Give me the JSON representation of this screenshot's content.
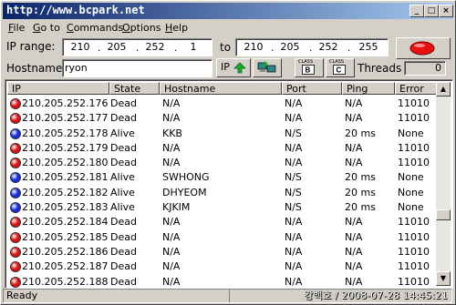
{
  "window": {
    "title": "http://www.bcpark.net",
    "min_glyph": "_",
    "max_glyph": "□",
    "close_glyph": "×"
  },
  "menu": [
    {
      "accel": "F",
      "rest": "ile"
    },
    {
      "accel": "G",
      "rest": "o to"
    },
    {
      "accel": "C",
      "rest": "ommands"
    },
    {
      "accel": "O",
      "rest": "ptions"
    },
    {
      "accel": "H",
      "rest": "elp"
    }
  ],
  "range": {
    "label": "IP range:",
    "from": [
      "210",
      "205",
      "252",
      "1"
    ],
    "to_label": "to",
    "to": [
      "210",
      "205",
      "252",
      "255"
    ]
  },
  "hostname": {
    "label": "Hostname:",
    "value": "ryon"
  },
  "tools": {
    "ip_up_label": "IP",
    "class_b_label": "CLASS",
    "class_c_label": "CLASS",
    "threads_label": "Threads",
    "threads_value": "0"
  },
  "columns": [
    "IP",
    "State",
    "Hostname",
    "Port",
    "Ping",
    "Error"
  ],
  "rows": [
    {
      "ip": "210.205.252.176",
      "state": "Dead",
      "host": "N/A",
      "port": "N/A",
      "ping": "N/A",
      "error": "11010",
      "color": "#e01010"
    },
    {
      "ip": "210.205.252.177",
      "state": "Dead",
      "host": "N/A",
      "port": "N/A",
      "ping": "N/A",
      "error": "11010",
      "color": "#e01010"
    },
    {
      "ip": "210.205.252.178",
      "state": "Alive",
      "host": "KKB",
      "port": "N/S",
      "ping": "20 ms",
      "error": "None",
      "color": "#1030e0"
    },
    {
      "ip": "210.205.252.179",
      "state": "Dead",
      "host": "N/A",
      "port": "N/A",
      "ping": "N/A",
      "error": "11010",
      "color": "#e01010"
    },
    {
      "ip": "210.205.252.180",
      "state": "Dead",
      "host": "N/A",
      "port": "N/A",
      "ping": "N/A",
      "error": "11010",
      "color": "#e01010"
    },
    {
      "ip": "210.205.252.181",
      "state": "Alive",
      "host": "SWHONG",
      "port": "N/S",
      "ping": "20 ms",
      "error": "None",
      "color": "#1030e0"
    },
    {
      "ip": "210.205.252.182",
      "state": "Alive",
      "host": "DHYEOM",
      "port": "N/S",
      "ping": "20 ms",
      "error": "None",
      "color": "#1030e0"
    },
    {
      "ip": "210.205.252.183",
      "state": "Alive",
      "host": "KJKIM",
      "port": "N/S",
      "ping": "20 ms",
      "error": "None",
      "color": "#1030e0"
    },
    {
      "ip": "210.205.252.184",
      "state": "Dead",
      "host": "N/A",
      "port": "N/A",
      "ping": "N/A",
      "error": "11010",
      "color": "#e01010"
    },
    {
      "ip": "210.205.252.185",
      "state": "Dead",
      "host": "N/A",
      "port": "N/A",
      "ping": "N/A",
      "error": "11010",
      "color": "#e01010"
    },
    {
      "ip": "210.205.252.186",
      "state": "Dead",
      "host": "N/A",
      "port": "N/A",
      "ping": "N/A",
      "error": "11010",
      "color": "#e01010"
    },
    {
      "ip": "210.205.252.187",
      "state": "Dead",
      "host": "N/A",
      "port": "N/A",
      "ping": "N/A",
      "error": "11010",
      "color": "#e01010"
    },
    {
      "ip": "210.205.252.188",
      "state": "Dead",
      "host": "N/A",
      "port": "N/A",
      "ping": "N/A",
      "error": "11010",
      "color": "#e01010"
    }
  ],
  "status": {
    "text": "Ready",
    "watermark": "강백호 / 2008-07-28 14:45:21"
  },
  "icons": {
    "start_button": "red-oval-start-icon",
    "ip_up": "ip-green-arrow-icon",
    "range_fill": "computers-arrow-icon",
    "class_b": "class-b-icon",
    "class_c": "class-c-icon"
  }
}
